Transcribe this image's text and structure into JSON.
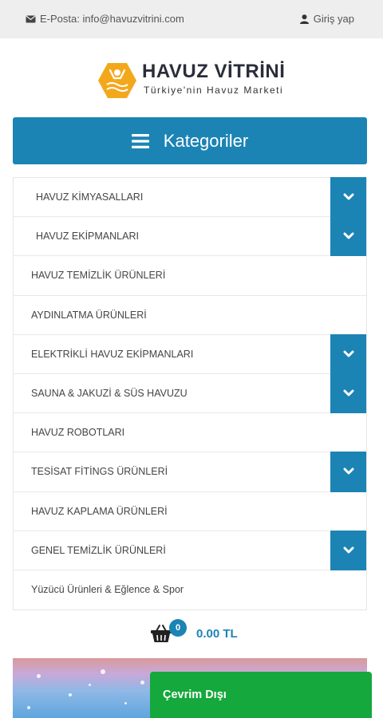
{
  "topbar": {
    "email_text": "E-Posta: info@havuzvitrini.com",
    "login_text": "Giriş yap"
  },
  "logo": {
    "brand": "HAVUZ VİTRİNİ",
    "tagline": "Türkiye'nin Havuz Marketi"
  },
  "categories": {
    "title": "Kategoriler",
    "items": [
      {
        "label": "HAVUZ KİMYASALLARI",
        "expandable": true
      },
      {
        "label": "HAVUZ EKİPMANLARI",
        "expandable": true
      },
      {
        "label": "HAVUZ TEMİZLİK ÜRÜNLERİ",
        "expandable": false
      },
      {
        "label": "AYDINLATMA ÜRÜNLERİ",
        "expandable": false
      },
      {
        "label": "ELEKTRİKLİ HAVUZ EKİPMANLARI",
        "expandable": true
      },
      {
        "label": "SAUNA & JAKUZİ & SÜS HAVUZU",
        "expandable": true
      },
      {
        "label": "HAVUZ ROBOTLARI",
        "expandable": false
      },
      {
        "label": "TESİSAT FİTİNGS ÜRÜNLERİ",
        "expandable": true
      },
      {
        "label": "HAVUZ KAPLAMA ÜRÜNLERİ",
        "expandable": false
      },
      {
        "label": "GENEL TEMİZLİK ÜRÜNLERİ",
        "expandable": true
      },
      {
        "label": "Yüzücü Ürünleri & Eğlence & Spor",
        "expandable": false
      }
    ]
  },
  "cart": {
    "count": "0",
    "total": "0.00 TL"
  },
  "chat": {
    "status": "Çevrim Dışı"
  },
  "colors": {
    "accent": "#1c84b4",
    "chat_green": "#15a83c",
    "topbar_bg": "#eeeeee"
  }
}
